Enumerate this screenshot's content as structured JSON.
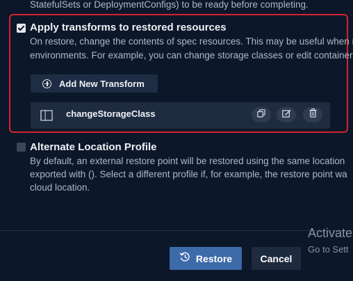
{
  "previous_section": {
    "description_tail": "StatefulSets or DeploymentConfigs) to be ready before completing."
  },
  "transforms_section": {
    "checked": true,
    "heading": "Apply transforms to restored resources",
    "description_line1": "On restore, change the contents of spec resources. This may be useful when r",
    "description_line2": "environments. For example, you can change storage classes or edit container",
    "add_button_label": "Add New Transform",
    "transforms": [
      {
        "name": "changeStorageClass"
      }
    ],
    "row_actions": [
      "copy-icon",
      "edit-icon",
      "delete-icon"
    ]
  },
  "alternate_location_section": {
    "checked": false,
    "heading": "Alternate Location Profile",
    "description_line1": "By default, an external restore point will be restored using the same location",
    "description_line2": "exported with (). Select a different profile if, for example, the restore point wa",
    "description_line3": "cloud location."
  },
  "footer": {
    "restore_label": "Restore",
    "cancel_label": "Cancel"
  },
  "watermark": {
    "title": "Activate",
    "subtitle": "Go to Sett"
  },
  "colors": {
    "background": "#0c1729",
    "highlight_border": "#d4232f",
    "primary_button": "#3d6aa8",
    "secondary_button": "#1e2a3e"
  }
}
